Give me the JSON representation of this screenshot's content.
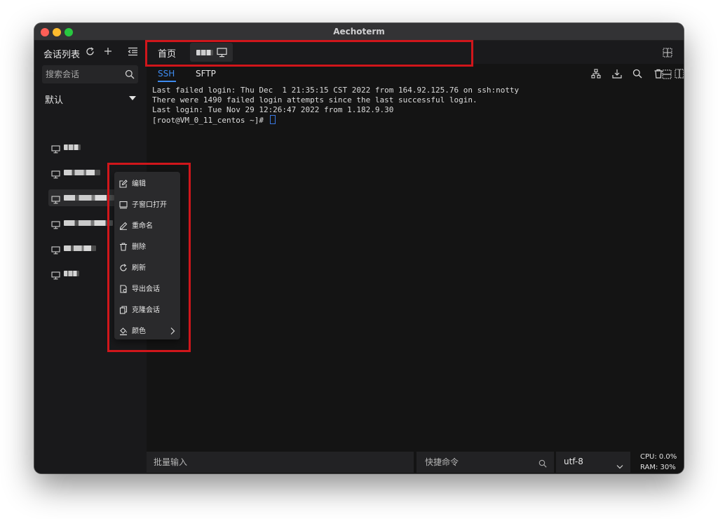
{
  "window": {
    "title": "Aechoterm"
  },
  "sidebar": {
    "header_label": "会话列表",
    "search_placeholder": "搜索会话",
    "group_label": "默认",
    "sessions": [
      {
        "name": "(redacted)",
        "selected": false
      },
      {
        "name": "(redacted)",
        "selected": false
      },
      {
        "name": "(redacted)",
        "selected": true
      },
      {
        "name": "(redacted)",
        "selected": false
      },
      {
        "name": "(redacted)",
        "selected": false
      },
      {
        "name": "(redacted)",
        "selected": false
      }
    ]
  },
  "tabs": {
    "home_label": "首页"
  },
  "subtabs": {
    "ssh": "SSH",
    "sftp": "SFTP"
  },
  "terminal": {
    "lines": [
      "Last failed login: Thu Dec  1 21:35:15 CST 2022 from 164.92.125.76 on ssh:notty",
      "There were 1490 failed login attempts since the last successful login.",
      "Last login: Tue Nov 29 12:26:47 2022 from 1.182.9.30",
      "[root@VM_0_11_centos ~]# "
    ]
  },
  "context_menu": {
    "items": [
      {
        "label": "编辑",
        "icon": "edit-icon"
      },
      {
        "label": "子窗口打开",
        "icon": "window-icon"
      },
      {
        "label": "重命名",
        "icon": "pencil-icon"
      },
      {
        "label": "删除",
        "icon": "trash-icon"
      },
      {
        "label": "刷新",
        "icon": "refresh-icon"
      },
      {
        "label": "导出会话",
        "icon": "export-icon"
      },
      {
        "label": "克隆会话",
        "icon": "copy-icon"
      },
      {
        "label": "颜色",
        "icon": "color-fill-icon",
        "has_submenu": true
      }
    ]
  },
  "bottombar": {
    "batch_placeholder": "批量输入",
    "quick_placeholder": "快捷命令",
    "encoding": "utf-8",
    "cpu": "CPU: 0.0%",
    "ram": "RAM: 30%"
  },
  "colors": {
    "accent": "#3d8bef",
    "highlight_box": "#d0161b",
    "background": "#141414"
  }
}
